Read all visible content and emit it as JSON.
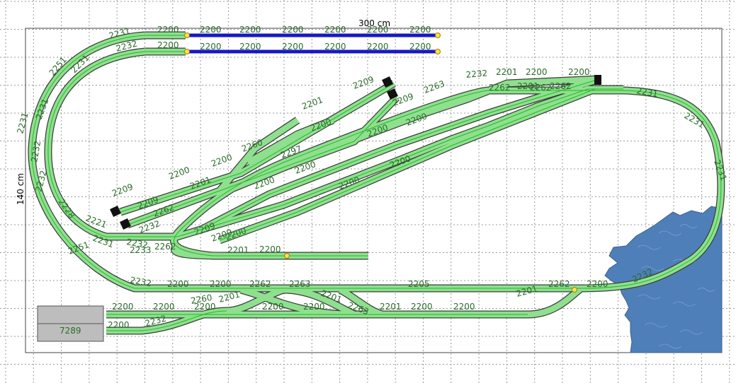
{
  "board": {
    "width_label": "300 cm",
    "height_label": "140 cm",
    "station_label": "7289"
  },
  "colors": {
    "track_bed": "#8ee08e",
    "track_edge": "#3d3d3d",
    "label": "#2a6b2a",
    "siding_blue": "#1717c8",
    "water": "#4f7fb8",
    "station": "#bdbdbd"
  },
  "track_labels": [
    "2231",
    "2200",
    "2200",
    "2200",
    "2200",
    "2200",
    "2200",
    "2200",
    "2232",
    "2200",
    "2200",
    "2200",
    "2200",
    "2200",
    "2200",
    "2200",
    "2251",
    "2231",
    "2231",
    "2231",
    "2232",
    "2232",
    "2228",
    "2221",
    "2231",
    "2251",
    "2232",
    "2201",
    "2200",
    "2200",
    "2262",
    "2262",
    "2201",
    "2262",
    "2231",
    "2231",
    "2231",
    "2209",
    "2209",
    "2263",
    "2201",
    "2200",
    "2200",
    "2200",
    "2209",
    "2209",
    "2232",
    "2200",
    "2200",
    "2260",
    "2297",
    "2201",
    "2209",
    "2209",
    "2262",
    "2232",
    "2233",
    "2262",
    "2200",
    "2200",
    "2200",
    "2200",
    "2200",
    "2201",
    "2200",
    "2232",
    "2200",
    "2200",
    "2262",
    "2263",
    "2201",
    "2205",
    "2262",
    "2200",
    "2201",
    "2232",
    "2200",
    "2200",
    "2200",
    "2260",
    "2201",
    "2200",
    "2200",
    "2263",
    "2201",
    "2200",
    "2200",
    "2232",
    "2200",
    "7289"
  ]
}
